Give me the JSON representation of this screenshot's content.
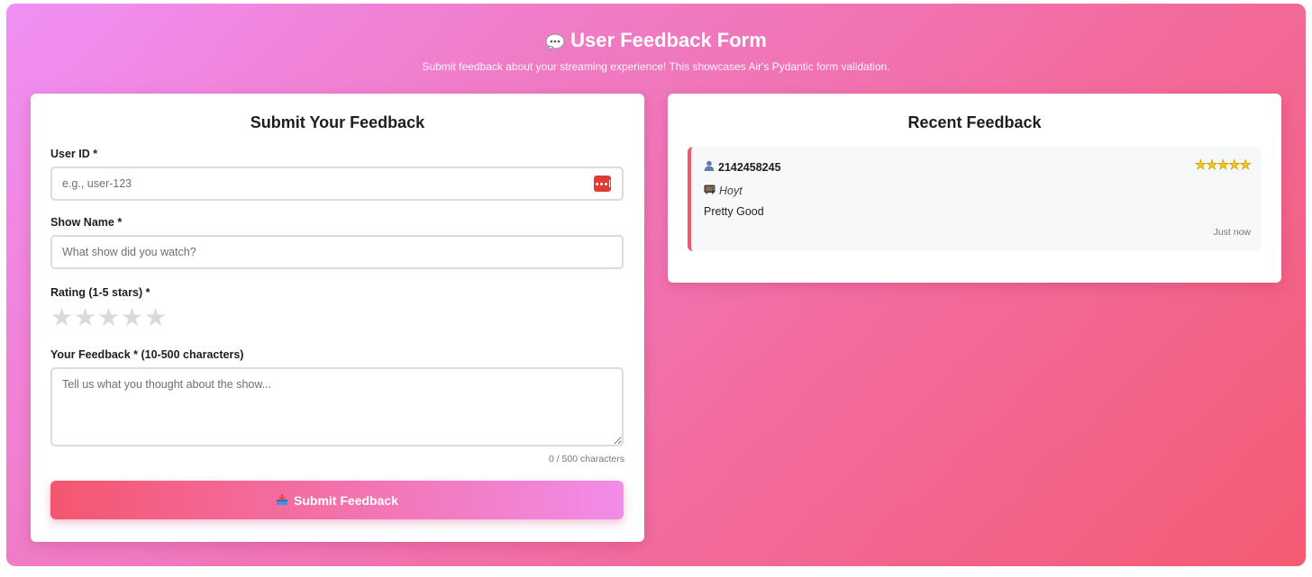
{
  "header": {
    "title": "User Feedback Form",
    "title_icon": "speech-bubble-icon",
    "subtitle": "Submit feedback about your streaming experience! This showcases Air's Pydantic form validation."
  },
  "form": {
    "title": "Submit Your Feedback",
    "user_id": {
      "label": "User ID *",
      "placeholder": "e.g., user-123",
      "value": ""
    },
    "show_name": {
      "label": "Show Name *",
      "placeholder": "What show did you watch?",
      "value": ""
    },
    "rating": {
      "label": "Rating (1-5 stars) *",
      "value": 0,
      "max": 5,
      "stars": [
        "★",
        "★",
        "★",
        "★",
        "★"
      ]
    },
    "feedback": {
      "label": "Your Feedback * (10-500 characters)",
      "placeholder": "Tell us what you thought about the show...",
      "value": ""
    },
    "char_count": "0 / 500 characters",
    "submit_label": "Submit Feedback",
    "submit_icon": "inbox-tray-icon"
  },
  "recent": {
    "title": "Recent Feedback",
    "items": [
      {
        "user_icon": "user-silhouette-icon",
        "user": "2142458245",
        "rating": 5,
        "rating_stars": "★★★★★",
        "show_icon": "tv-icon",
        "show": "Hoyt",
        "comment": "Pretty Good",
        "time": "Just now"
      }
    ]
  },
  "colors": {
    "accent": "#f4566f",
    "gradient_start": "#f090f5",
    "gradient_end": "#f45b73",
    "star_empty": "#dadada",
    "star_filled": "#f5c518",
    "password_manager": "#e03a32"
  }
}
